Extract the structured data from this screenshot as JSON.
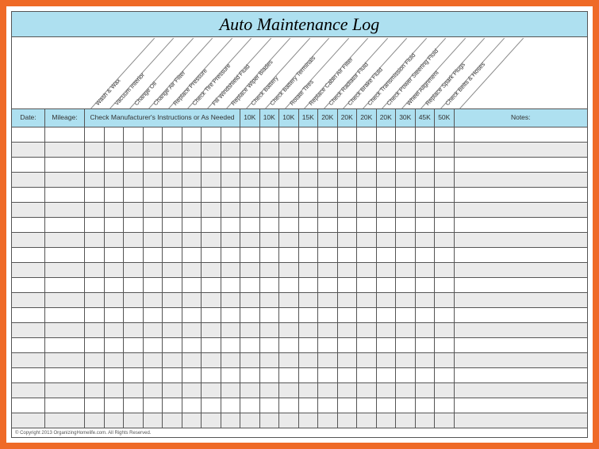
{
  "title": "Auto Maintenance Log",
  "headers": {
    "date": "Date:",
    "mileage": "Mileage:",
    "instructions": "Check Manufacturer's Instructions or As Needed",
    "notes": "Notes:"
  },
  "diagonal_tasks": [
    "Wash & Wax",
    "Vacuum Interior",
    "Change Oil",
    "Change Air Filter",
    "Replace Pressure",
    "Check Tire Pressure",
    "Fill Windshield Fluid",
    "Replace Wiper Blades",
    "Check Battery",
    "Check Battery Terminals",
    "Rotate Tires",
    "Replace Cabin Air Filter",
    "Check Radiator Fluid",
    "Check Brake Fluid",
    "Check Transmission Fluid",
    "Check Power Steering Fluid",
    "Wheel Alignment",
    "Replace Spark Plugs",
    "Check Belts & Hoses"
  ],
  "interval_labels": [
    "10K",
    "10K",
    "10K",
    "15K",
    "20K",
    "20K",
    "20K",
    "20K",
    "30K",
    "45K",
    "50K"
  ],
  "row_count": 20,
  "copyright": "© Copyright 2013 OrganizingHomelife.com. All Rights Reserved."
}
